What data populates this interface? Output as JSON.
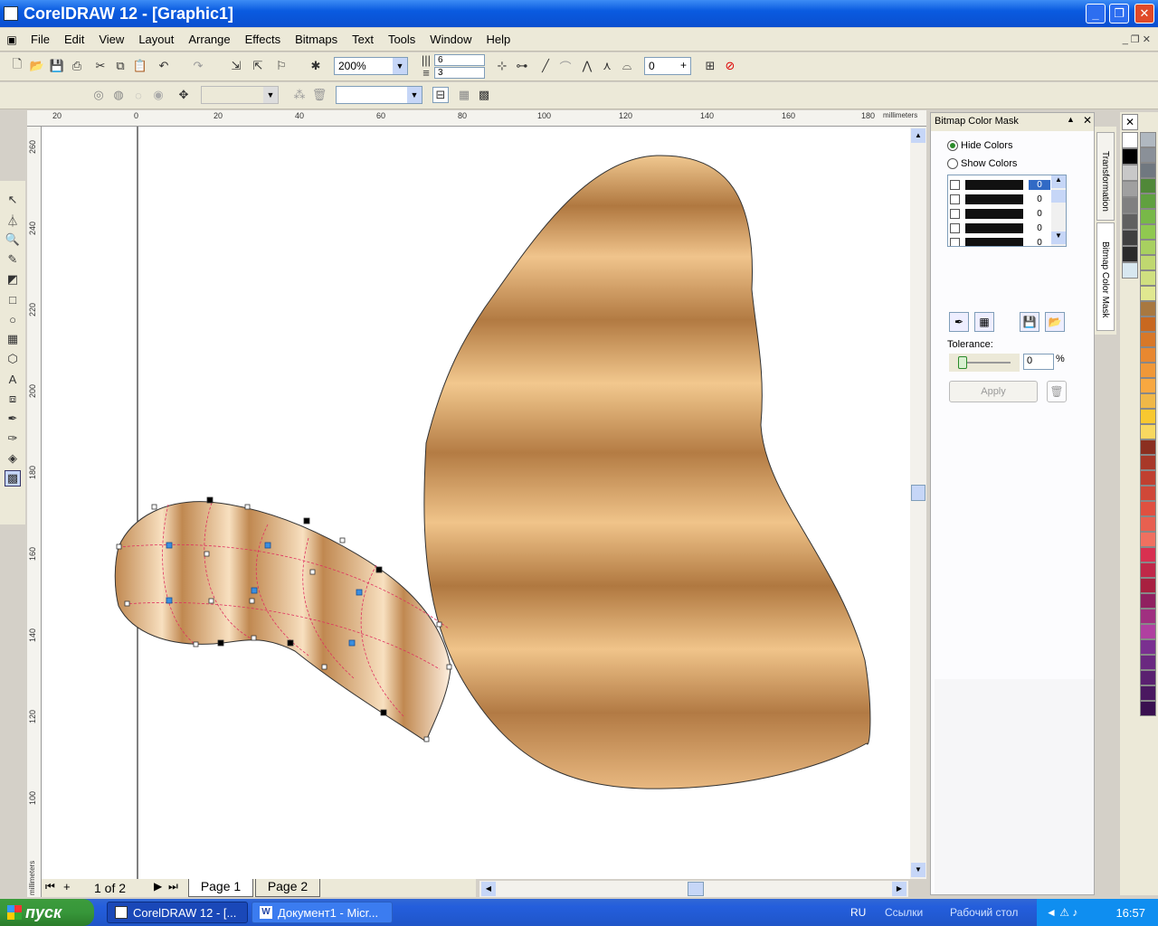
{
  "window": {
    "title": "CorelDRAW 12 - [Graphic1]"
  },
  "menu": [
    "File",
    "Edit",
    "View",
    "Layout",
    "Arrange",
    "Effects",
    "Bitmaps",
    "Text",
    "Tools",
    "Window",
    "Help"
  ],
  "toolbar": {
    "zoom": "200%",
    "copies_h": "6",
    "copies_v": "3",
    "angle": "0"
  },
  "ruler": {
    "unit": "millimeters",
    "h_ticks": [
      "20",
      "0",
      "20",
      "40",
      "60",
      "80",
      "100",
      "120",
      "140",
      "160",
      "180"
    ],
    "v_ticks": [
      "260",
      "240",
      "220",
      "200",
      "180",
      "160",
      "140",
      "120",
      "100"
    ]
  },
  "pages": {
    "counter": "1 of 2",
    "tabs": [
      "Page 1",
      "Page 2"
    ]
  },
  "docker": {
    "title": "Bitmap Color Mask",
    "hide_colors": "Hide Colors",
    "show_colors": "Show Colors",
    "mask_rows": [
      "0",
      "0",
      "0",
      "0",
      "0"
    ],
    "tolerance_label": "Tolerance:",
    "tolerance_value": "0",
    "tolerance_unit": "%",
    "apply": "Apply",
    "tabs": [
      "Transformation",
      "Bitmap Color Mask"
    ]
  },
  "palette": [
    "#ffffff",
    "#000000",
    "#c8c8c8",
    "#a0a0a0",
    "#808080",
    "#606060",
    "#404040",
    "#2a2a2a",
    "#d8e8f0",
    "#b0b8c0",
    "#8a9098",
    "#707880",
    "#508838",
    "#60a040",
    "#78b848",
    "#90c850",
    "#a8d060",
    "#c0d870",
    "#d0e080",
    "#e0e890",
    "#a87840",
    "#c86820",
    "#d87828",
    "#e88830",
    "#f09838",
    "#f8a840",
    "#f0b848",
    "#f8c830",
    "#f8d860",
    "#8b2f20",
    "#a83828",
    "#c04030",
    "#d04838",
    "#e05040",
    "#e86050",
    "#f07060",
    "#d83050",
    "#c02848",
    "#a82040",
    "#902060",
    "#a03080",
    "#b040a0",
    "#7a3090",
    "#6a2880",
    "#5a2070",
    "#4a1860",
    "#3a1050"
  ],
  "taskbar": {
    "start": "пуск",
    "tasks": [
      "CorelDRAW 12 - [...",
      "Документ1 - Micr..."
    ],
    "lang": "RU",
    "links": "Ссылки",
    "desktop": "Рабочий стол",
    "clock": "16:57"
  }
}
